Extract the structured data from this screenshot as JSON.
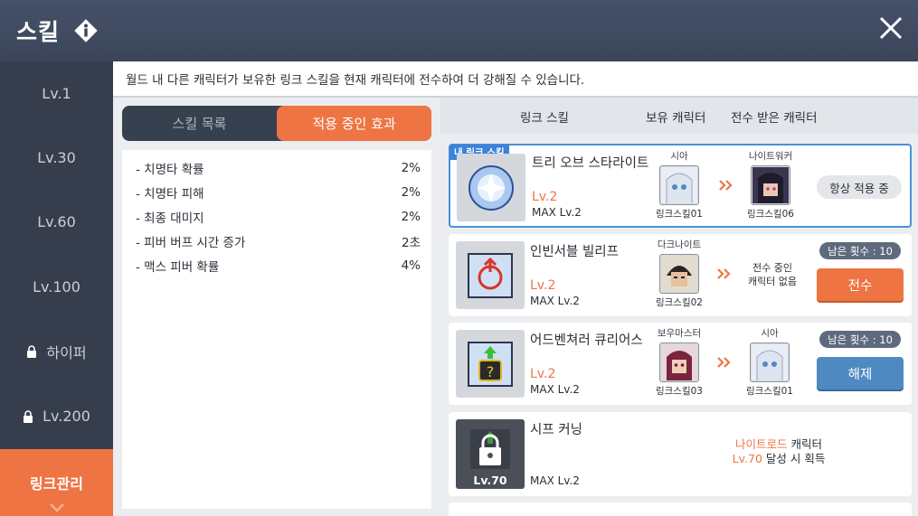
{
  "header": {
    "title": "스킬",
    "info_icon": "info-diamond-icon",
    "close_icon": "close-x-icon"
  },
  "sidebar": {
    "items": [
      {
        "label": "Lv.1",
        "locked": false,
        "active": false
      },
      {
        "label": "Lv.30",
        "locked": false,
        "active": false
      },
      {
        "label": "Lv.60",
        "locked": false,
        "active": false
      },
      {
        "label": "Lv.100",
        "locked": false,
        "active": false
      },
      {
        "label": "하이퍼",
        "locked": true,
        "active": false
      },
      {
        "label": "Lv.200",
        "locked": true,
        "active": false
      },
      {
        "label": "링크관리",
        "locked": false,
        "active": true
      }
    ]
  },
  "description": "월드 내 다른 캐릭터가 보유한 링크 스킬을 현재 캐릭터에 전수하여 더 강해질 수 있습니다.",
  "tabs": [
    {
      "label": "스킬 목록",
      "active": false
    },
    {
      "label": "적용 중인 효과",
      "active": true
    }
  ],
  "effects": [
    {
      "name": "- 치명타 확률",
      "value": "2%"
    },
    {
      "name": "- 치명타 피해",
      "value": "2%"
    },
    {
      "name": "- 최종 대미지",
      "value": "2%"
    },
    {
      "name": "- 피버 버프 시간 증가",
      "value": "2초"
    },
    {
      "name": "- 맥스 피버 확률",
      "value": "4%"
    }
  ],
  "table_header": {
    "col_skill": "링크 스킬",
    "col_owner": "보유 캐릭터",
    "col_receiver": "전수 받은 캐릭터"
  },
  "cards": [
    {
      "tag": "내 링크 스킬",
      "name": "트리 오브 스타라이트",
      "lv": "Lv.2",
      "max": "MAX Lv.2",
      "owner": {
        "class": "시아",
        "link": "링크스킬01"
      },
      "receiver": {
        "class": "나이트워커",
        "link": "링크스킬06"
      },
      "status": "항상 적용 중"
    },
    {
      "name": "인빈서블 빌리프",
      "lv": "Lv.2",
      "max": "MAX Lv.2",
      "owner": {
        "class": "다크나이트",
        "link": "링크스킬02"
      },
      "receiver_text_1": "전수 중인",
      "receiver_text_2": "캐릭터 없음",
      "remaining": "남은 횟수 : 10",
      "button": "전수"
    },
    {
      "name": "어드벤쳐러 큐리어스",
      "lv": "Lv.2",
      "max": "MAX Lv.2",
      "owner": {
        "class": "보우마스터",
        "link": "링크스킬03"
      },
      "receiver": {
        "class": "시아",
        "link": "링크스킬01"
      },
      "remaining": "남은 횟수 : 10",
      "button": "해제"
    },
    {
      "name": "시프 커닝",
      "lock_lv": "Lv.70",
      "max": "MAX Lv.2",
      "cond_class": "나이트로드",
      "cond_class_suffix": " 캐릭터",
      "cond_lv": "Lv.70",
      "cond_lv_suffix": " 달성 시 획득"
    }
  ],
  "colors": {
    "accent": "#ef7443",
    "header": "#3b4559",
    "sidebar": "#363e4d",
    "blue_button": "#4f89c2",
    "mine_border": "#4a8fdc"
  }
}
